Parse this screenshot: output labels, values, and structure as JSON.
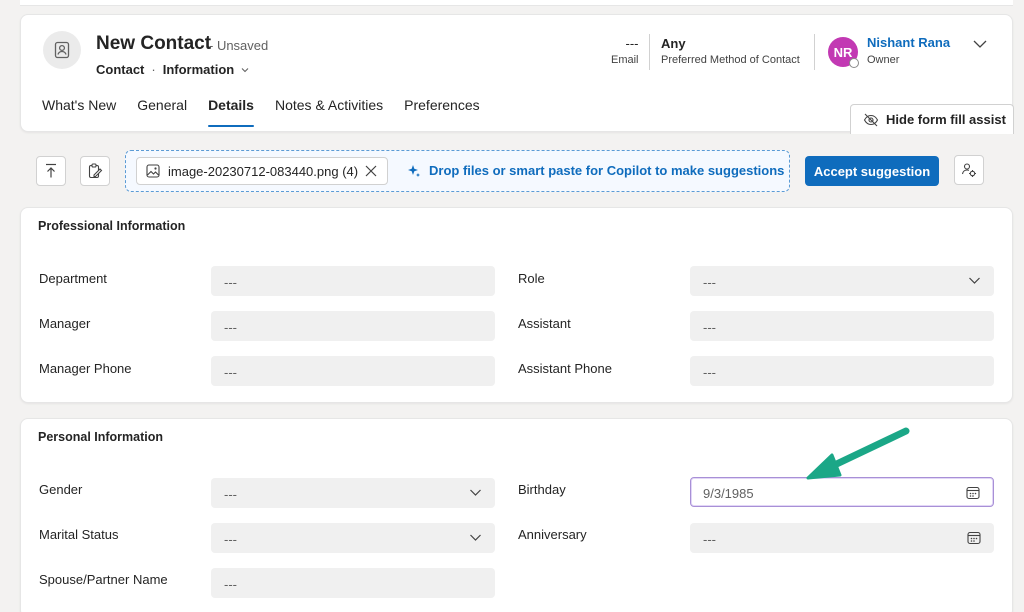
{
  "record": {
    "title": "New Contact",
    "status": "- Unsaved",
    "entity": "Contact",
    "separator": "·",
    "form": "Information"
  },
  "header_fields": [
    {
      "value": "---",
      "label": "Email"
    },
    {
      "value": "Any",
      "label": "Preferred Method of Contact"
    }
  ],
  "owner": {
    "initials": "NR",
    "name": "Nishant Rana",
    "label": "Owner",
    "avatar_color": "#c239b3"
  },
  "tabs": [
    {
      "label": "What's New",
      "active": false
    },
    {
      "label": "General",
      "active": false
    },
    {
      "label": "Details",
      "active": true
    },
    {
      "label": "Notes & Activities",
      "active": false
    },
    {
      "label": "Preferences",
      "active": false
    }
  ],
  "assist": {
    "label": "Hide form fill assist"
  },
  "toolbar": {
    "attachment": "image-20230712-083440.png (4)",
    "drop_hint": "Drop files or smart paste for Copilot to make suggestions",
    "accept_label": "Accept suggestion"
  },
  "professional": {
    "title": "Professional Information",
    "fields": {
      "department": {
        "label": "Department",
        "value": "---"
      },
      "role": {
        "label": "Role",
        "value": "---"
      },
      "manager": {
        "label": "Manager",
        "value": "---"
      },
      "assistant": {
        "label": "Assistant",
        "value": "---"
      },
      "manager_phone": {
        "label": "Manager Phone",
        "value": "---"
      },
      "assistant_phone": {
        "label": "Assistant Phone",
        "value": "---"
      }
    }
  },
  "personal": {
    "title": "Personal Information",
    "fields": {
      "gender": {
        "label": "Gender",
        "value": "---"
      },
      "birthday": {
        "label": "Birthday",
        "value": "9/3/1985"
      },
      "marital_status": {
        "label": "Marital Status",
        "value": "---"
      },
      "anniversary": {
        "label": "Anniversary",
        "value": "---"
      },
      "spouse": {
        "label": "Spouse/Partner Name",
        "value": "---"
      }
    }
  },
  "colors": {
    "accent": "#0f6cbd",
    "annotation_arrow": "#1ba787"
  }
}
